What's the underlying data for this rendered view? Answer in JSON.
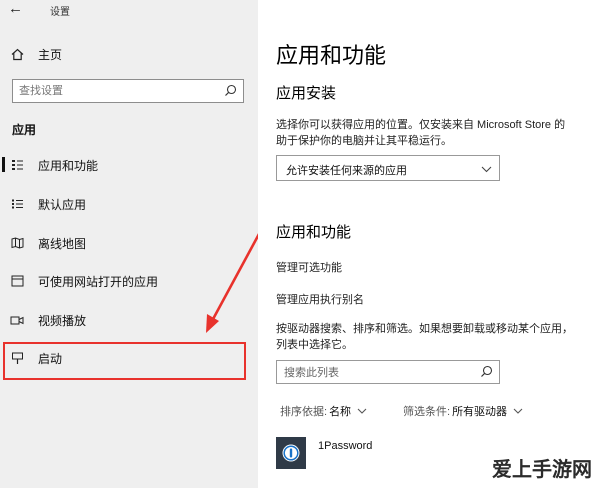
{
  "window": {
    "title": "设置",
    "back_glyph": "←"
  },
  "sidebar": {
    "home": {
      "label": "主页",
      "icon": "home-icon"
    },
    "search": {
      "placeholder": "查找设置"
    },
    "section_title": "应用",
    "items": [
      {
        "label": "应用和功能",
        "icon": "apps-list-icon",
        "active": true
      },
      {
        "label": "默认应用",
        "icon": "default-apps-icon"
      },
      {
        "label": "离线地图",
        "icon": "map-icon"
      },
      {
        "label": "可使用网站打开的应用",
        "icon": "website-app-icon"
      },
      {
        "label": "视频播放",
        "icon": "video-icon"
      },
      {
        "label": "启动",
        "icon": "startup-icon",
        "highlighted": true
      }
    ]
  },
  "main": {
    "title": "应用和功能",
    "install": {
      "heading": "应用安装",
      "desc_line1": "选择你可以获得应用的位置。仅安装来自 Microsoft Store 的",
      "desc_line2": "助于保护你的电脑并让其平稳运行。",
      "dropdown_value": "允许安装任何来源的应用"
    },
    "features": {
      "heading": "应用和功能",
      "link_optional": "管理可选功能",
      "link_alias": "管理应用执行别名",
      "desc_line1": "按驱动器搜索、排序和筛选。如果想要卸载或移动某个应用，",
      "desc_line2": "列表中选择它。",
      "search_placeholder": "搜索此列表",
      "sort_label": "排序依据:",
      "sort_value": "名称",
      "filter_label": "筛选条件:",
      "filter_value": "所有驱动器",
      "apps": [
        {
          "name": "1Password"
        }
      ]
    }
  },
  "watermark": "爱上手游网",
  "colors": {
    "highlight": "#e8322c",
    "sidebar_bg": "#efefef"
  }
}
